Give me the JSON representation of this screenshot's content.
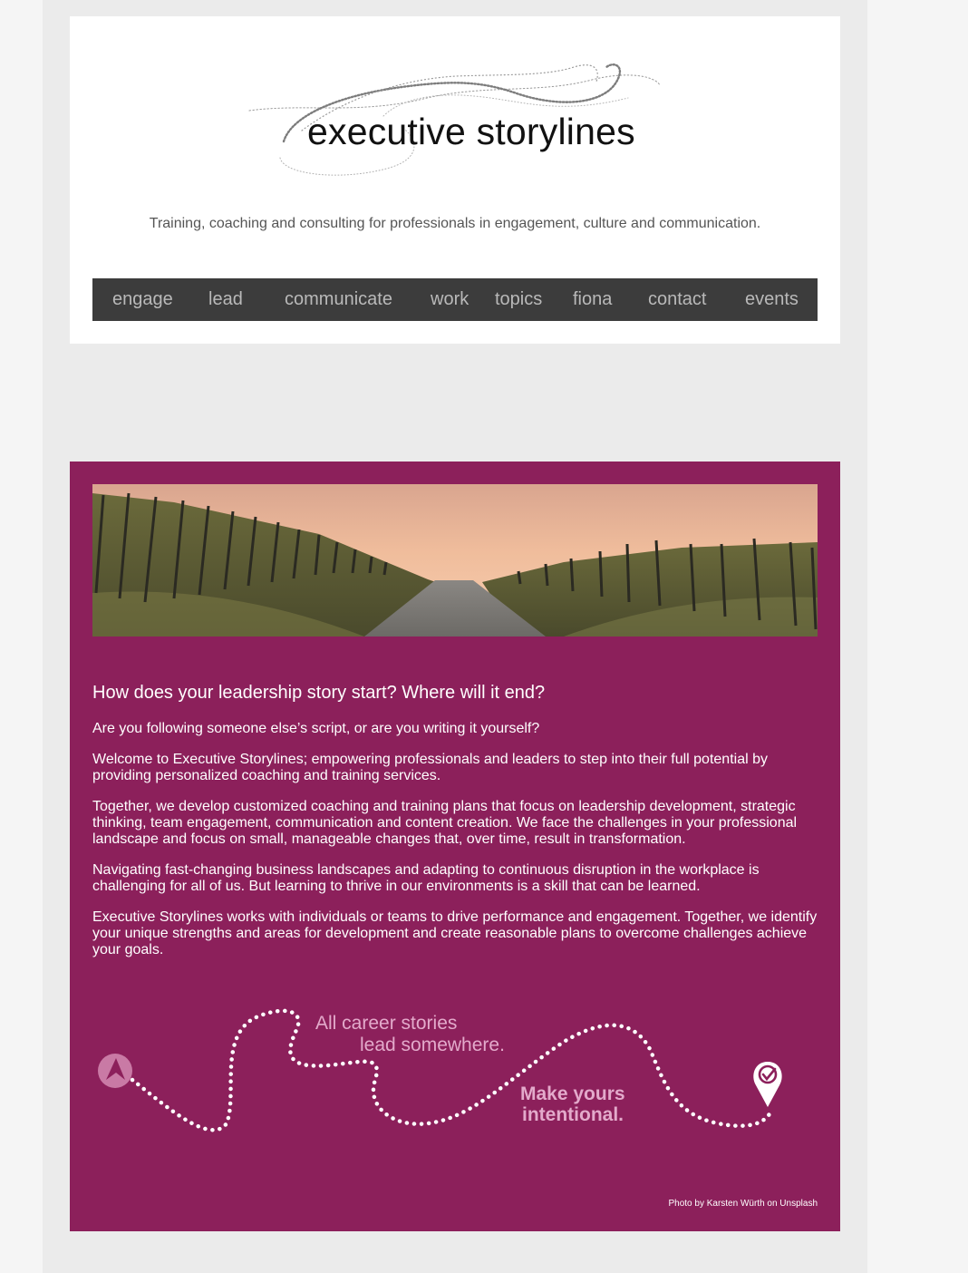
{
  "header": {
    "logo_text": "executive storylines",
    "tagline": "Training, coaching and consulting for professionals in engagement, culture and communication."
  },
  "nav": {
    "items": [
      "engage",
      "lead",
      "communicate",
      "work",
      "topics",
      "fiona",
      "contact",
      "events"
    ]
  },
  "intro": {
    "heading": "How does your leadership story start? Where will it end?",
    "paragraphs": [
      "Are you following someone else’s script, or are you writing it yourself?",
      "Welcome to Executive Storylines; empowering professionals and leaders to step into their full potential by providing personalized coaching and training services.",
      "Together, we develop customized coaching and training plans that focus on leadership development, strategic thinking, team engagement, communication and content creation. We face the challenges in your professional landscape and focus on small, manageable changes that, over time, result in transformation.",
      "Navigating fast-changing business landscapes and adapting to continuous disruption in the workplace is challenging for all of us. But learning to thrive in our environments is a skill that can be learned.",
      "Executive Storylines works with individuals or teams to drive performance and engagement. Together, we identify your unique strengths and areas for development and create reasonable plans to overcome challenges achieve your goals."
    ]
  },
  "journey": {
    "line1": "All career stories",
    "line2": "lead somewhere.",
    "bold1": "Make yours",
    "bold2": "intentional."
  },
  "credit": "Photo by Karsten Würth on Unsplash",
  "colors": {
    "accent": "#8c205b",
    "nav_bg": "#3c3c3c",
    "nav_text": "#b9b9b9",
    "journey_text": "#e3aacb"
  }
}
